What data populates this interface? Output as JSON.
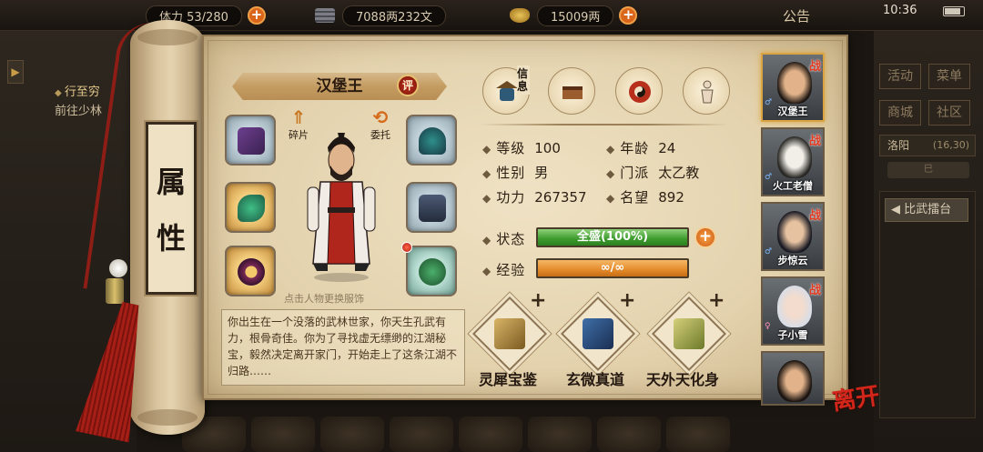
{
  "top": {
    "resource_partial": "体力 53/280",
    "copper": "7088两232文",
    "silver": "15009两",
    "notice": "公告",
    "time": "10:36"
  },
  "left": {
    "quest_title": "行至穷",
    "quest_desc": "前往少林"
  },
  "right": {
    "buttons": [
      "活动",
      "菜单",
      "商城",
      "社区"
    ],
    "location": "洛阳",
    "coord": "(16,30)",
    "sub": "巳",
    "arena": "比武擂台"
  },
  "tab": {
    "char1": "属",
    "char2": "性"
  },
  "hero": {
    "name": "汉堡王",
    "rate": "评",
    "fragments": "碎片",
    "entrust": "委托",
    "hint": "点击人物更换服饰"
  },
  "categories": {
    "active_label": "信息",
    "icons": [
      "hat-scroll-icon",
      "book-box-icon",
      "bagua-icon",
      "meridian-icon"
    ]
  },
  "stats": {
    "level_label": "等级",
    "level": "100",
    "age_label": "年龄",
    "age": "24",
    "gender_label": "性别",
    "gender": "男",
    "sect_label": "门派",
    "sect": "太乙教",
    "power_label": "功力",
    "power": "267357",
    "fame_label": "名望",
    "fame": "892",
    "state_label": "状态",
    "state": "全盛(100%)",
    "state_pct": 100,
    "exp_label": "经验",
    "exp": "∞/∞"
  },
  "description": "你出生在一个没落的武林世家，你天生孔武有力，根骨奇佳。你为了寻找虚无缥缈的江湖秘宝，毅然决定离开家门，开始走上了这条江湖不归路……",
  "books": [
    {
      "label": "灵犀宝鉴",
      "plus": "+"
    },
    {
      "label": "玄微真道",
      "plus": "+"
    },
    {
      "label": "天外天化身",
      "plus": "+"
    }
  ],
  "party": [
    {
      "name": "汉堡王",
      "war": "战"
    },
    {
      "name": "火工老僧",
      "war": "战"
    },
    {
      "name": "步惊云",
      "war": "战"
    },
    {
      "name": "子小雪",
      "war": "战"
    },
    {
      "name": "",
      "war": ""
    }
  ],
  "leave": "离开",
  "colors": {
    "paper": "#e9dbb9",
    "state_bar": "#3b9b2b",
    "exp_bar": "#e38a2b",
    "accent_red": "#d3261a"
  }
}
